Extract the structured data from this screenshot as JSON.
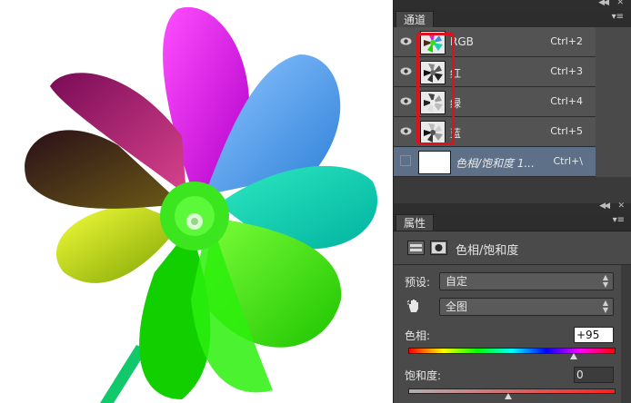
{
  "channels_panel": {
    "tab_label": "通道",
    "rows": [
      {
        "label": "RGB",
        "shortcut": "Ctrl+2"
      },
      {
        "label": "红",
        "shortcut": "Ctrl+3"
      },
      {
        "label": "绿",
        "shortcut": "Ctrl+4"
      },
      {
        "label": "蓝",
        "shortcut": "Ctrl+5"
      },
      {
        "label": "色相/饱和度 1...",
        "shortcut": "Ctrl+\\"
      }
    ]
  },
  "properties_panel": {
    "tab_label": "属性",
    "title": "色相/饱和度",
    "preset_label": "预设:",
    "preset_value": "自定",
    "range_value": "全图",
    "hue_label": "色相:",
    "hue_value": "+95",
    "saturation_label": "饱和度:",
    "saturation_value": "0"
  },
  "colors": {
    "panel_bg": "#3a3a3a",
    "selected_row": "#5d7087",
    "highlight": "#e0101c"
  }
}
